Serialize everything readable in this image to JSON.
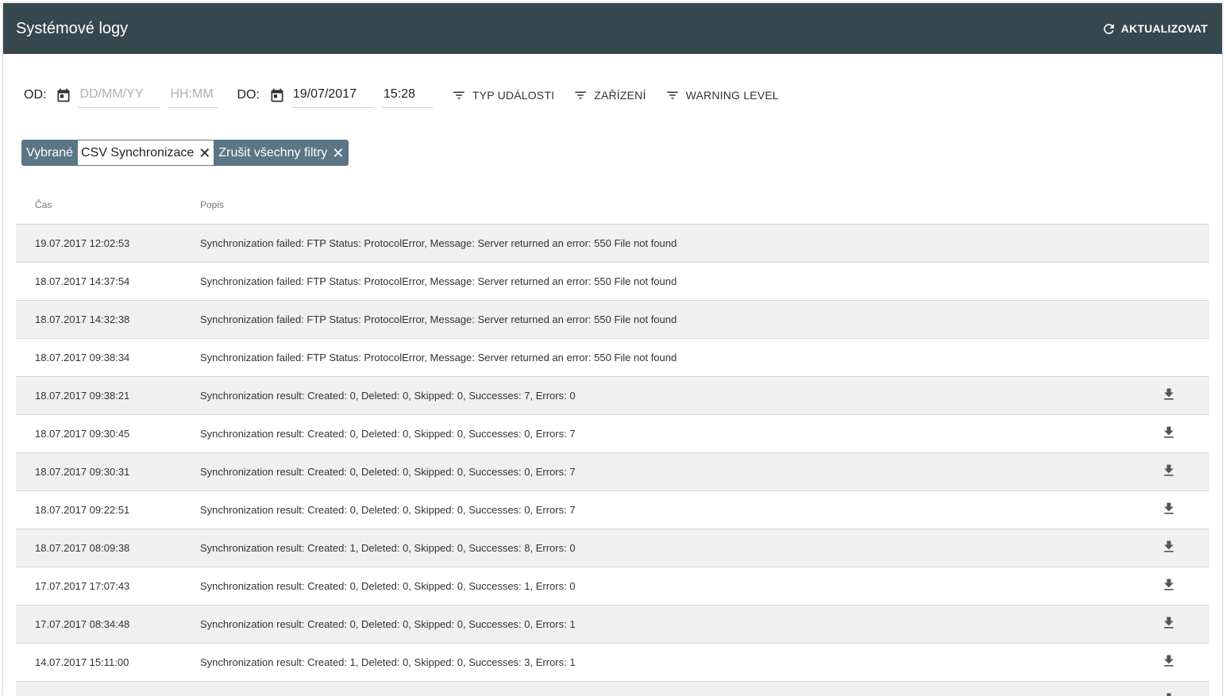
{
  "header": {
    "title": "Systémové logy",
    "refresh_label": "AKTUALIZOVAT"
  },
  "filters": {
    "from_label": "OD:",
    "from_date_placeholder": "DD/MM/YY",
    "from_time_placeholder": "HH:MM",
    "to_label": "DO:",
    "to_date": "19/07/2017",
    "to_time": "15:28",
    "buttons": [
      "TYP UDÁLOSTI",
      "ZAŘÍZENÍ",
      "WARNING LEVEL"
    ]
  },
  "chips": {
    "selected_label": "Vybrané",
    "selected_value": "CSV Synchronizace",
    "clear_all": "Zrušit všechny filtry"
  },
  "table": {
    "columns": [
      "Čas",
      "Popis"
    ],
    "rows": [
      {
        "time": "19.07.2017 12:02:53",
        "desc": "Synchronization failed: FTP Status: ProtocolError, Message: Server returned an error: 550 File not found",
        "download": false
      },
      {
        "time": "18.07.2017 14:37:54",
        "desc": "Synchronization failed: FTP Status: ProtocolError, Message: Server returned an error: 550 File not found",
        "download": false
      },
      {
        "time": "18.07.2017 14:32:38",
        "desc": "Synchronization failed: FTP Status: ProtocolError, Message: Server returned an error: 550 File not found",
        "download": false
      },
      {
        "time": "18.07.2017 09:38:34",
        "desc": "Synchronization failed: FTP Status: ProtocolError, Message: Server returned an error: 550 File not found",
        "download": false
      },
      {
        "time": "18.07.2017 09:38:21",
        "desc": "Synchronization result: Created: 0, Deleted: 0, Skipped: 0, Successes: 7, Errors: 0",
        "download": true
      },
      {
        "time": "18.07.2017 09:30:45",
        "desc": "Synchronization result: Created: 0, Deleted: 0, Skipped: 0, Successes: 0, Errors: 7",
        "download": true
      },
      {
        "time": "18.07.2017 09:30:31",
        "desc": "Synchronization result: Created: 0, Deleted: 0, Skipped: 0, Successes: 0, Errors: 7",
        "download": true
      },
      {
        "time": "18.07.2017 09:22:51",
        "desc": "Synchronization result: Created: 0, Deleted: 0, Skipped: 0, Successes: 0, Errors: 7",
        "download": true
      },
      {
        "time": "18.07.2017 08:09:38",
        "desc": "Synchronization result: Created: 1, Deleted: 0, Skipped: 0, Successes: 8, Errors: 0",
        "download": true
      },
      {
        "time": "17.07.2017 17:07:43",
        "desc": "Synchronization result: Created: 0, Deleted: 0, Skipped: 0, Successes: 1, Errors: 0",
        "download": true
      },
      {
        "time": "17.07.2017 08:34:48",
        "desc": "Synchronization result: Created: 0, Deleted: 0, Skipped: 0, Successes: 0, Errors: 1",
        "download": true
      },
      {
        "time": "14.07.2017 15:11:00",
        "desc": "Synchronization result: Created: 1, Deleted: 0, Skipped: 0, Successes: 3, Errors: 1",
        "download": true
      },
      {
        "time": "",
        "desc": "",
        "download": true
      }
    ]
  },
  "colors": {
    "topbar": "#37474f",
    "chip": "#5b7685",
    "row_alt": "#f0f0f0"
  },
  "icons": {
    "refresh": "refresh-icon",
    "calendar": "calendar-icon",
    "filter": "filter-list-icon",
    "clear": "close-icon",
    "download": "download-icon"
  }
}
